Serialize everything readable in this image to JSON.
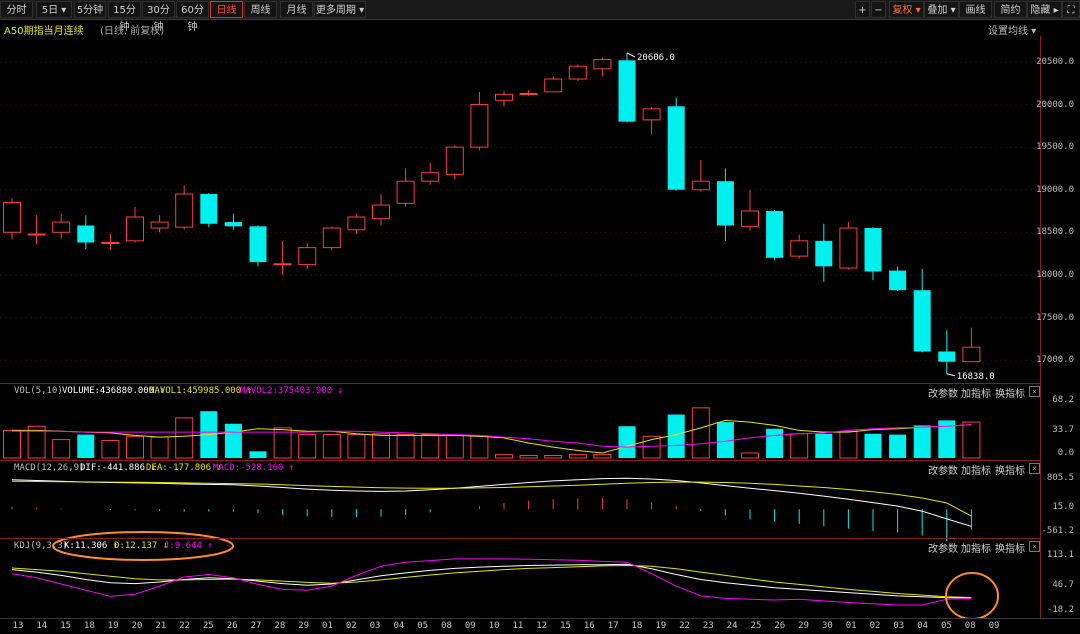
{
  "toolbar": {
    "left": [
      {
        "label": "分时",
        "x": 0,
        "w": 33
      },
      {
        "label": "5日 ▾",
        "x": 36,
        "w": 36
      },
      {
        "label": "5分钟",
        "x": 74,
        "w": 32
      },
      {
        "label": "15分钟",
        "x": 108,
        "w": 33
      },
      {
        "label": "30分钟",
        "x": 142,
        "w": 33
      },
      {
        "label": "60分钟",
        "x": 176,
        "w": 33
      },
      {
        "label": "日线",
        "x": 210,
        "w": 33,
        "active": true
      },
      {
        "label": "周线",
        "x": 244,
        "w": 33
      },
      {
        "label": "月线",
        "x": 280,
        "w": 33
      },
      {
        "label": "更多周期 ▾",
        "x": 314,
        "w": 52
      }
    ],
    "right": [
      {
        "label": "+",
        "x": 855,
        "w": 15
      },
      {
        "label": "−",
        "x": 871,
        "w": 15
      },
      {
        "label": "复权 ▾",
        "x": 889,
        "w": 35,
        "orange": true
      },
      {
        "label": "叠加 ▾",
        "x": 924,
        "w": 35
      },
      {
        "label": "画线",
        "x": 959,
        "w": 33
      },
      {
        "label": "简约",
        "x": 994,
        "w": 33
      },
      {
        "label": "隐藏 ▸",
        "x": 1027,
        "w": 35
      },
      {
        "label": "⛶",
        "x": 1062,
        "w": 18
      }
    ]
  },
  "title": {
    "name": "A50期指当月连续",
    "sub": "(日线, 前复权)",
    "settings": "设置均线 ▾"
  },
  "price_axis": [
    "20500.0",
    "20000.0",
    "19500.0",
    "19000.0",
    "18500.0",
    "18000.0",
    "17500.0",
    "17000.0"
  ],
  "annotations": {
    "high": "20606.0",
    "low": "16838.0"
  },
  "vol": {
    "head": "VOL(5,10)",
    "volume": "VOLUME:436880.000 ↓",
    "mavol1": "MAVOL1:459985.000 ↑",
    "mavol2": "MAVOL2:375403.900 ↓",
    "axis": [
      "68.2",
      "33.7",
      "0.0"
    ]
  },
  "macd": {
    "head": "MACD(12,26,9)",
    "dif": "DIF:-441.886 ↓",
    "dea": "DEA:-177.806 ↓",
    "macd": "MACD:-528.160 ↑",
    "axis": [
      "805.5",
      "15.0",
      "-561.2"
    ]
  },
  "kdj": {
    "head": "KDJ(9,3,3)",
    "k": "K:11.306 ↑",
    "d": "D:12.137 ↓",
    "j": "J:9.644 ↑",
    "axis": [
      "113.1",
      "46.7",
      "-18.2"
    ]
  },
  "panel_buttons": {
    "params": "改参数",
    "add": "加指标",
    "change": "换指标",
    "close": "×"
  },
  "dates": [
    "13",
    "14",
    "15",
    "18",
    "19",
    "20",
    "21",
    "22",
    "25",
    "26",
    "27",
    "28",
    "29",
    "01",
    "02",
    "03",
    "04",
    "05",
    "08",
    "09",
    "10",
    "11",
    "12",
    "15",
    "16",
    "17",
    "18",
    "19",
    "22",
    "23",
    "24",
    "25",
    "26",
    "29",
    "30",
    "01",
    "02",
    "03",
    "04",
    "05",
    "08",
    "09"
  ],
  "colors": {
    "up": "#ff3c3c",
    "down": "#00f0f0",
    "yellow": "#e6e600",
    "magenta": "#ff00ff",
    "white": "#ffffff",
    "highlight": "#ff8c28"
  },
  "chart_data": {
    "type": "candlestick",
    "ylim": [
      16838,
      20606
    ],
    "candles": [
      {
        "o": 18500,
        "c": 18850,
        "h": 18900,
        "l": 18420
      },
      {
        "o": 18480,
        "c": 18480,
        "h": 18700,
        "l": 18360
      },
      {
        "o": 18500,
        "c": 18620,
        "h": 18720,
        "l": 18420
      },
      {
        "o": 18580,
        "c": 18380,
        "h": 18700,
        "l": 18300
      },
      {
        "o": 18380,
        "c": 18380,
        "h": 18480,
        "l": 18290
      },
      {
        "o": 18400,
        "c": 18680,
        "h": 18800,
        "l": 18380
      },
      {
        "o": 18550,
        "c": 18620,
        "h": 18700,
        "l": 18500
      },
      {
        "o": 18560,
        "c": 18950,
        "h": 19050,
        "l": 18530
      },
      {
        "o": 18950,
        "c": 18600,
        "h": 18960,
        "l": 18560
      },
      {
        "o": 18620,
        "c": 18570,
        "h": 18720,
        "l": 18530
      },
      {
        "o": 18570,
        "c": 18150,
        "h": 18580,
        "l": 18100
      },
      {
        "o": 18130,
        "c": 18130,
        "h": 18400,
        "l": 18000
      },
      {
        "o": 18120,
        "c": 18320,
        "h": 18370,
        "l": 18070
      },
      {
        "o": 18320,
        "c": 18550,
        "h": 18570,
        "l": 18290
      },
      {
        "o": 18530,
        "c": 18680,
        "h": 18720,
        "l": 18480
      },
      {
        "o": 18660,
        "c": 18820,
        "h": 18950,
        "l": 18580
      },
      {
        "o": 18840,
        "c": 19100,
        "h": 19250,
        "l": 18800
      },
      {
        "o": 19100,
        "c": 19200,
        "h": 19320,
        "l": 19060
      },
      {
        "o": 19180,
        "c": 19500,
        "h": 19520,
        "l": 19120
      },
      {
        "o": 19500,
        "c": 20000,
        "h": 20150,
        "l": 19460
      },
      {
        "o": 20050,
        "c": 20120,
        "h": 20160,
        "l": 19980
      },
      {
        "o": 20130,
        "c": 20130,
        "h": 20170,
        "l": 20100
      },
      {
        "o": 20150,
        "c": 20300,
        "h": 20330,
        "l": 20150
      },
      {
        "o": 20300,
        "c": 20450,
        "h": 20470,
        "l": 20280
      },
      {
        "o": 20420,
        "c": 20530,
        "h": 20550,
        "l": 20330
      },
      {
        "o": 20520,
        "c": 19800,
        "h": 20606,
        "l": 19790
      },
      {
        "o": 19820,
        "c": 19950,
        "h": 19970,
        "l": 19650
      },
      {
        "o": 19980,
        "c": 19000,
        "h": 20080,
        "l": 18990
      },
      {
        "o": 19000,
        "c": 19100,
        "h": 19350,
        "l": 18980
      },
      {
        "o": 19100,
        "c": 18580,
        "h": 19250,
        "l": 18400
      },
      {
        "o": 18570,
        "c": 18750,
        "h": 19000,
        "l": 18520
      },
      {
        "o": 18750,
        "c": 18200,
        "h": 18760,
        "l": 18170
      },
      {
        "o": 18220,
        "c": 18400,
        "h": 18470,
        "l": 18190
      },
      {
        "o": 18400,
        "c": 18100,
        "h": 18600,
        "l": 17920
      },
      {
        "o": 18080,
        "c": 18550,
        "h": 18620,
        "l": 18060
      },
      {
        "o": 18550,
        "c": 18040,
        "h": 18560,
        "l": 17940
      },
      {
        "o": 18050,
        "c": 17820,
        "h": 18100,
        "l": 17810
      },
      {
        "o": 17820,
        "c": 17100,
        "h": 18070,
        "l": 17090
      },
      {
        "o": 17100,
        "c": 16980,
        "h": 17350,
        "l": 16838
      },
      {
        "o": 16980,
        "c": 17150,
        "h": 17380,
        "l": 16980
      }
    ],
    "volume": [
      33,
      38,
      22,
      28,
      21,
      26,
      25,
      48,
      56,
      41,
      8,
      36,
      28,
      28,
      28,
      29,
      28,
      28,
      27,
      26,
      4,
      3,
      3,
      4,
      4,
      38,
      26,
      52,
      60,
      43,
      6,
      35,
      29,
      29,
      32,
      29,
      28,
      39,
      45,
      43
    ],
    "mavol1": [
      33,
      33,
      32,
      31,
      30,
      27,
      25,
      26,
      28,
      31,
      35,
      34,
      32,
      32,
      29,
      27,
      27,
      27,
      27,
      26,
      24,
      18,
      13,
      9,
      6,
      14,
      22,
      28,
      36,
      45,
      43,
      39,
      33,
      31,
      31,
      34,
      35,
      37,
      38,
      40
    ],
    "mavol2": [
      32,
      32,
      32,
      31,
      31,
      31,
      31,
      31,
      31,
      31,
      31,
      31,
      31,
      32,
      32,
      31,
      30,
      29,
      28,
      27,
      25,
      23,
      20,
      18,
      14,
      13,
      14,
      15,
      17,
      20,
      24,
      27,
      29,
      30,
      33,
      35,
      36,
      37,
      38,
      40
    ],
    "macd_dif": [
      760,
      740,
      720,
      700,
      690,
      680,
      670,
      650,
      640,
      630,
      600,
      560,
      520,
      490,
      470,
      460,
      470,
      500,
      540,
      590,
      640,
      690,
      730,
      760,
      790,
      800,
      780,
      740,
      680,
      610,
      540,
      480,
      410,
      340,
      260,
      170,
      80,
      -50,
      -250,
      -441
    ],
    "macd_dea": [
      720,
      715,
      710,
      705,
      700,
      695,
      690,
      680,
      670,
      660,
      650,
      630,
      610,
      590,
      570,
      555,
      545,
      540,
      540,
      550,
      560,
      580,
      600,
      620,
      645,
      670,
      690,
      700,
      700,
      690,
      670,
      640,
      600,
      560,
      510,
      450,
      380,
      290,
      160,
      -177
    ],
    "macd_hist": [
      60,
      40,
      20,
      0,
      -20,
      -30,
      -40,
      -60,
      -60,
      -60,
      -100,
      -140,
      -180,
      -200,
      -200,
      -190,
      -150,
      -80,
      0,
      80,
      160,
      220,
      260,
      280,
      290,
      260,
      180,
      80,
      -40,
      -160,
      -260,
      -320,
      -380,
      -440,
      -500,
      -560,
      -600,
      -680,
      -820,
      -528
    ],
    "kdj_k": [
      80,
      74,
      66,
      56,
      48,
      46,
      50,
      56,
      60,
      58,
      52,
      46,
      42,
      45,
      55,
      65,
      72,
      78,
      83,
      86,
      88,
      90,
      91,
      92,
      92,
      93,
      82,
      68,
      56,
      48,
      42,
      36,
      32,
      28,
      24,
      20,
      16,
      14,
      12,
      11.306
    ],
    "kdj_d": [
      84,
      80,
      76,
      70,
      64,
      58,
      55,
      55,
      56,
      57,
      55,
      52,
      49,
      47,
      50,
      55,
      61,
      67,
      72,
      76,
      80,
      83,
      85,
      87,
      89,
      90,
      88,
      82,
      74,
      66,
      58,
      50,
      44,
      38,
      32,
      27,
      22,
      18,
      14,
      12.137
    ],
    "kdj_j": [
      70,
      60,
      45,
      30,
      15,
      20,
      40,
      62,
      68,
      60,
      44,
      32,
      30,
      40,
      66,
      88,
      98,
      102,
      106,
      106,
      106,
      105,
      104,
      103,
      100,
      98,
      70,
      40,
      16,
      10,
      8,
      6,
      8,
      4,
      0,
      -3,
      -6,
      -6,
      8,
      9.644
    ]
  }
}
